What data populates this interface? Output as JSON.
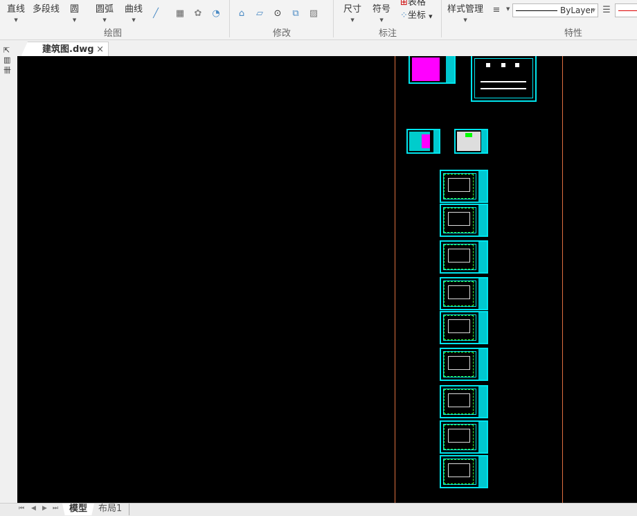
{
  "ribbon": {
    "draw": {
      "line": "直线",
      "polyline": "多段线",
      "circle": "圆",
      "arc": "圆弧",
      "curve": "曲线",
      "label": "绘图"
    },
    "modify": {
      "label": "修改"
    },
    "annotate": {
      "dimension": "尺寸",
      "symbol": "符号",
      "table": "表格",
      "coordinate": "坐标",
      "label": "标注"
    },
    "properties": {
      "style_manager": "样式管理",
      "linetype": "ByLayer",
      "label": "特性"
    }
  },
  "document_tab": {
    "title": "建筑图.dwg",
    "close": "×"
  },
  "layout_tabs": [
    {
      "label": "模型",
      "active": true
    },
    {
      "label": "布局1",
      "active": false
    }
  ],
  "colors": {
    "canvas": "#000000",
    "border": "#e07040",
    "sheet": "#00e5ee"
  }
}
